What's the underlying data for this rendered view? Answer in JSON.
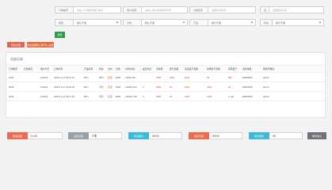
{
  "filters": {
    "order_no": {
      "label": "订单编号",
      "placeholder": "请输入订单编号或订单号"
    },
    "user_name": {
      "label": "用户名称",
      "placeholder": "请输入用户名称或手机号"
    },
    "order_range": {
      "label": "订单区间",
      "placeholder": "选择区间时间"
    },
    "to": {
      "label": "至",
      "placeholder": "选择结束时间"
    },
    "type": {
      "label": "类型",
      "value": "默认不选"
    },
    "direction": {
      "label": "方向",
      "value": "默认不选"
    },
    "product": {
      "label": "产品",
      "value": "默认不选"
    },
    "status": {
      "label": "状态",
      "value": "默认不选"
    }
  },
  "buttons": {
    "search": "搜索",
    "export": "导出全部",
    "import": "导出选择的订单",
    "import2": "导入交易"
  },
  "table": {
    "title": "全部记录",
    "headers": [
      "订单编号",
      "合约编号",
      "用户ID号",
      "订单时间",
      "产品名称",
      "状态",
      "方向",
      "分组",
      "时间/价格",
      "是否点位",
      "手续费",
      "盈亏金额",
      "买卖盈亏金额",
      "每笔盈亏金额",
      "实际盈亏",
      "资金余额",
      "所属代理商"
    ],
    "rows": [
      [
        "4040",
        "",
        "123123",
        "2025-12-27 00:10:01",
        "BTC",
        "BKS",
        "买涨",
        "6081",
        "115411.84",
        "",
        "¥500",
        "¥200",
        "¥200",
        "¥6",
        "¥80",
        "¥8000553",
        "admin"
      ],
      [
        "4039",
        "",
        "123123",
        "2025-12-27 00:02:22",
        "BTC",
        "平仓",
        "买涨",
        "6081",
        "115352.213",
        "0",
        "¥500",
        "¥0",
        "¥200",
        "¥200",
        "¥0",
        "¥8000553",
        "admin"
      ],
      [
        "4039",
        "",
        "123123",
        "2025-12-27 00:17:18",
        "BTC",
        "平仓",
        "买涨",
        "6081",
        "115342.749",
        "0",
        "¥500",
        "¥0",
        "¥160",
        "¥160",
        "¥-160",
        "¥8000555",
        "admin"
      ]
    ]
  },
  "bottom": {
    "set_balance": {
      "button": "修改余额",
      "value": "¥-80"
    },
    "set_points": {
      "button": "设置手续",
      "value": "0笔"
    },
    "win": {
      "button": "修改盈利",
      "value": "¥500"
    },
    "lose": {
      "button": "修改亏损",
      "value": "¥500"
    },
    "fee": {
      "button": "修改收费",
      "value": "¥0"
    },
    "confirm": {
      "button": "审核通过"
    }
  }
}
